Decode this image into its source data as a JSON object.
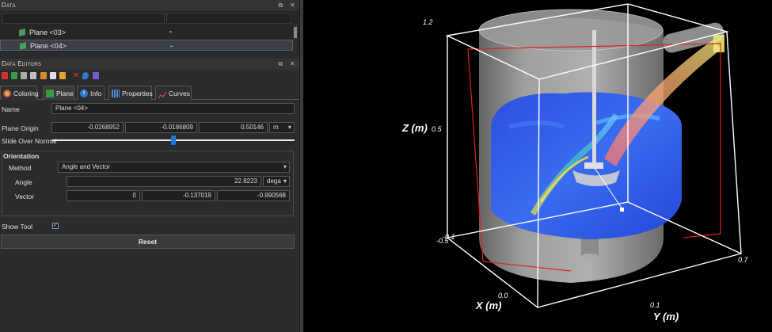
{
  "data_panel": {
    "title": "Data",
    "rows": [
      {
        "label": "Plane <03>"
      },
      {
        "label": "Plane <04>"
      }
    ]
  },
  "editors_panel": {
    "title": "Data Editors"
  },
  "tabs": [
    {
      "label": "Coloring",
      "icon": "palette-icon"
    },
    {
      "label": "Plane",
      "icon": "plane-icon"
    },
    {
      "label": "Info",
      "icon": "info-icon"
    },
    {
      "label": "Properties",
      "icon": "properties-icon"
    },
    {
      "label": "Curves",
      "icon": "curves-icon"
    }
  ],
  "form": {
    "name_label": "Name",
    "name_value": "Plane <04>",
    "origin_label": "Plane Origin",
    "origin_x": "-0.0268952",
    "origin_y": "-0.0186809",
    "origin_z": "0.50146",
    "origin_unit": "m",
    "slide_label": "Slide Over Normal",
    "slide_fraction": 0.5,
    "orientation_title": "Orientation",
    "method_label": "Method",
    "method_value": "Angle and Vector",
    "angle_label": "Angle",
    "angle_value": "22.8223",
    "angle_unit": "dega",
    "vector_label": "Vector",
    "vector_x": "0",
    "vector_y": "-0.137019",
    "vector_z": "-0.990568",
    "show_tool_label": "Show Tool",
    "show_tool_checked": true,
    "reset_label": "Reset"
  },
  "viewport": {
    "axis_z_label": "Z (m)",
    "axis_x_label": "X (m)",
    "axis_y_label": "Y (m)",
    "tick_z_top": "1.2",
    "tick_z_mid": "0.5",
    "tick_z_low1": "-0.1",
    "tick_z_low2": "-0.5",
    "tick_x": "0.0",
    "tick_y1": "0.1",
    "tick_y2": "0.7"
  }
}
